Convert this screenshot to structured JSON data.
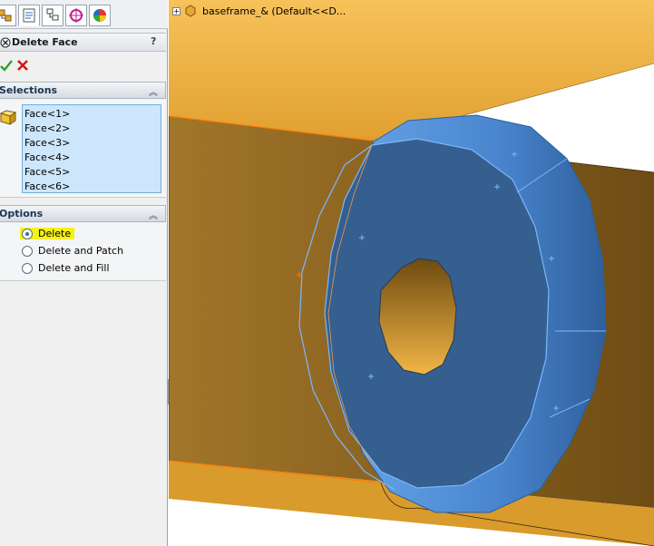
{
  "window": {
    "title": "Delete Face"
  },
  "tabs": [
    {
      "icon": "feature-manager-icon"
    },
    {
      "icon": "property-manager-icon"
    },
    {
      "icon": "configuration-manager-icon"
    },
    {
      "icon": "dimxpert-icon"
    },
    {
      "icon": "display-manager-icon"
    }
  ],
  "property_manager": {
    "title": "Delete Face",
    "help": "?",
    "ok_icon": "ok-check-icon",
    "cancel_icon": "cancel-x-icon"
  },
  "selections": {
    "title": "Selections",
    "items": [
      "Face<1>",
      "Face<2>",
      "Face<3>",
      "Face<4>",
      "Face<5>",
      "Face<6>"
    ]
  },
  "options": {
    "title": "Options",
    "items": [
      {
        "label": "Delete",
        "checked": true
      },
      {
        "label": "Delete and Patch",
        "checked": false
      },
      {
        "label": "Delete and Fill",
        "checked": false
      }
    ]
  },
  "tree": {
    "node_label": "baseframe_&  (Default<<D..."
  },
  "colors": {
    "body": "#e8a531",
    "body_shadow": "#7a5616",
    "selection": "#4d8fd6",
    "highlight": "#f4f21a"
  }
}
